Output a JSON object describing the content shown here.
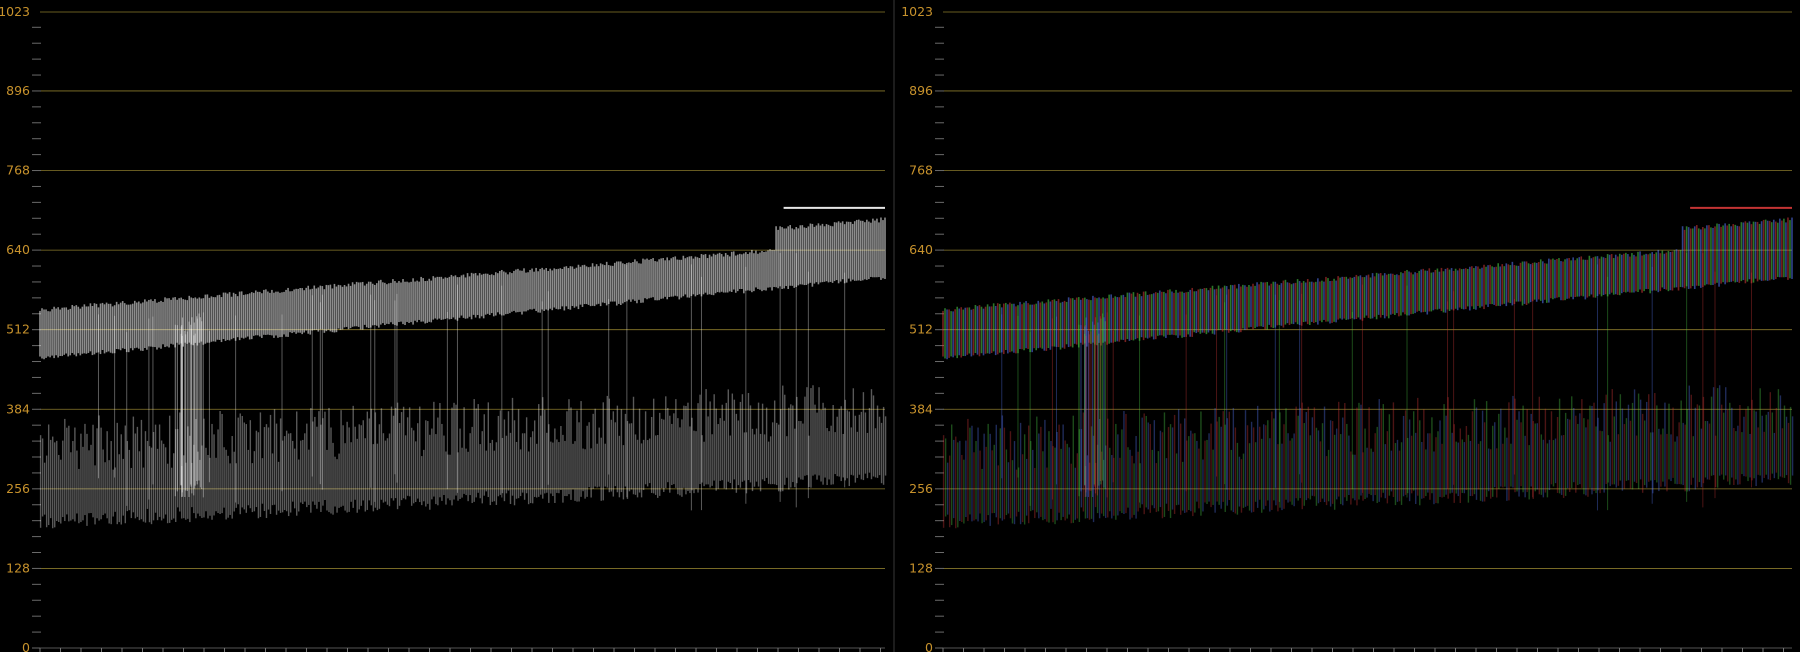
{
  "colors": {
    "background": "#000000",
    "gridline": "#8a7a2c",
    "tick_label": "#c7922c",
    "trace_luma": "#ffffff",
    "trace_red": "#d93a3a",
    "trace_green": "#4fd84a",
    "trace_blue": "#5a7aff"
  },
  "scale": {
    "ticks": [
      "1023",
      "896",
      "768",
      "640",
      "512",
      "384",
      "256",
      "128",
      "0"
    ]
  },
  "panels": [
    {
      "mode": "luma-waveform",
      "trace_color": "white"
    },
    {
      "mode": "rgb-overlay-waveform",
      "trace_colors": [
        "red",
        "green",
        "blue"
      ]
    }
  ]
}
